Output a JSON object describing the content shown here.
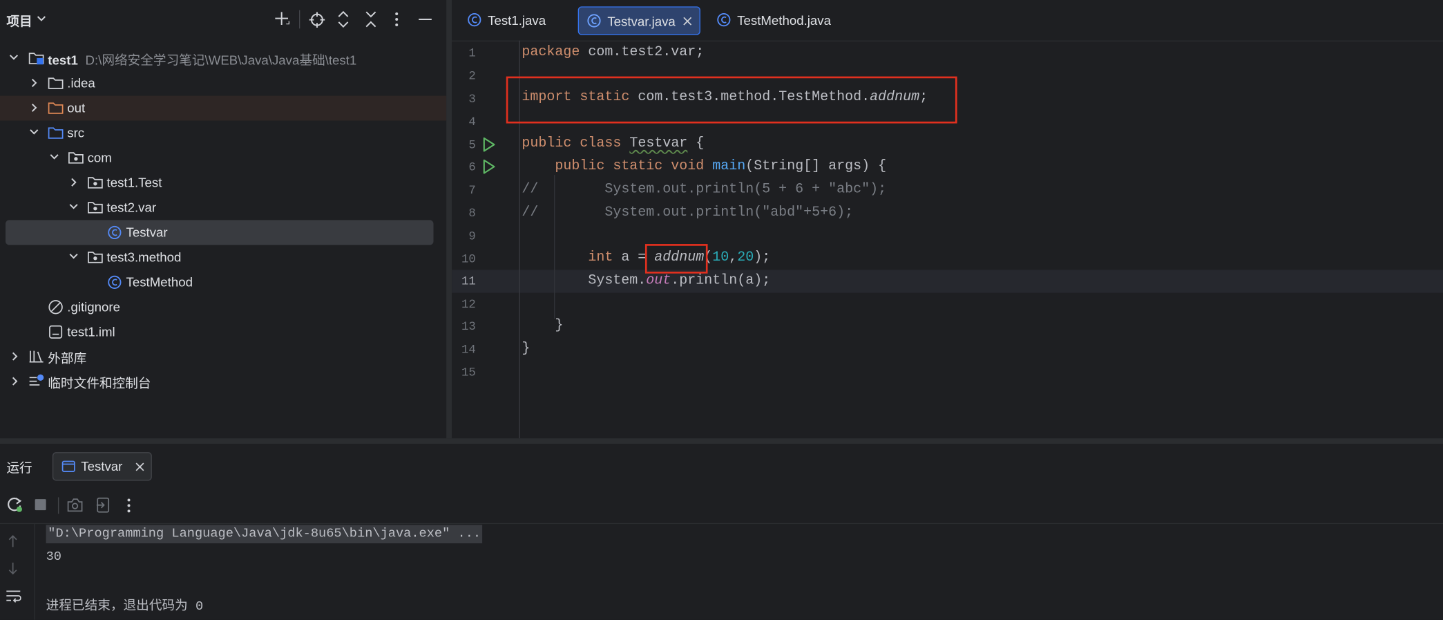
{
  "project_panel": {
    "title": "项目",
    "tree": [
      {
        "label": "test1",
        "path": "D:\\网络安全学习笔记\\WEB\\Java\\Java基础\\test1"
      },
      {
        "label": ".idea"
      },
      {
        "label": "out"
      },
      {
        "label": "src"
      },
      {
        "label": "com"
      },
      {
        "label": "test1.Test"
      },
      {
        "label": "test2.var"
      },
      {
        "label": "Testvar"
      },
      {
        "label": "test3.method"
      },
      {
        "label": "TestMethod"
      },
      {
        "label": ".gitignore"
      },
      {
        "label": "test1.iml"
      },
      {
        "label": "外部库"
      },
      {
        "label": "临时文件和控制台"
      }
    ]
  },
  "editor": {
    "tabs": [
      {
        "label": "Test1.java"
      },
      {
        "label": "Testvar.java"
      },
      {
        "label": "TestMethod.java"
      }
    ],
    "active_tab": "Testvar.java",
    "line_numbers": [
      "1",
      "2",
      "3",
      "4",
      "5",
      "6",
      "7",
      "8",
      "9",
      "10",
      "11",
      "12",
      "13",
      "14",
      "15"
    ],
    "current_line": "11",
    "code": {
      "l1_kw": "package",
      "l1_rest": " com.test2.var;",
      "l3_kw1": "import",
      "l3_kw2": " static",
      "l3_rest": " com.test3.method.TestMethod.",
      "l3_method": "addnum",
      "l3_end": ";",
      "l5_kw": "public class",
      "l5_cls": "Testvar",
      "l5_end": " {",
      "l6_kw": "public static void",
      "l6_fn": "main",
      "l6_rest": "(String[] args) {",
      "l7": "//        System.out.println(5 + 6 + \"abc\");",
      "l8": "//        System.out.println(\"abd\"+5+6);",
      "l10_kw": "int",
      "l10_a": " a = ",
      "l10_call": "addnum",
      "l10_open": "(",
      "l10_n1": "10",
      "l10_comma": ",",
      "l10_n2": "20",
      "l10_close": ");",
      "l11_sys": "System.",
      "l11_out": "out",
      "l11_rest": ".println(a);",
      "l13": "}",
      "l14": "}"
    }
  },
  "run_panel": {
    "title": "运行",
    "tab_label": "Testvar",
    "console": {
      "cmd": "\"D:\\Programming Language\\Java\\jdk-8u65\\bin\\java.exe\" ...",
      "output": "30",
      "exit": "进程已结束，退出代码为 0"
    }
  },
  "colors": {
    "accent": "#3574f0",
    "highlight_box": "#e1301f",
    "run_icon": "#5fb865"
  }
}
